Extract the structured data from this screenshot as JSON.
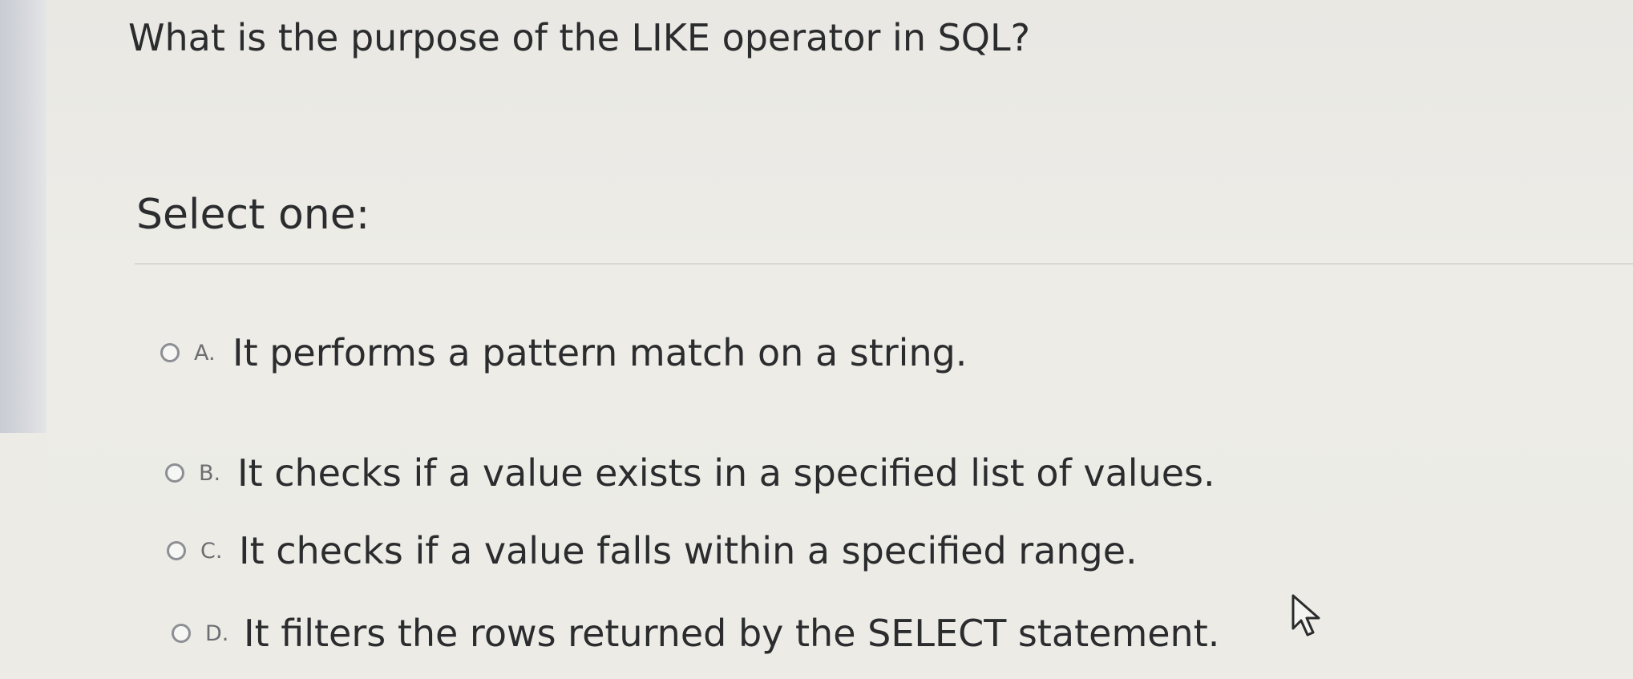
{
  "question": {
    "text": "What is the purpose of the LIKE operator in SQL?"
  },
  "prompt": "Select one:",
  "options": [
    {
      "letter": "A.",
      "text": "It performs a pattern match on a string."
    },
    {
      "letter": "B.",
      "text": "It checks if a value exists in a specified list of values."
    },
    {
      "letter": "C.",
      "text": "It checks if a value falls within a specified range."
    },
    {
      "letter": "D.",
      "text": "It filters the rows returned by the SELECT statement."
    }
  ],
  "icons": {
    "radio": "radio-unchecked-icon",
    "cursor": "mouse-pointer-icon"
  }
}
